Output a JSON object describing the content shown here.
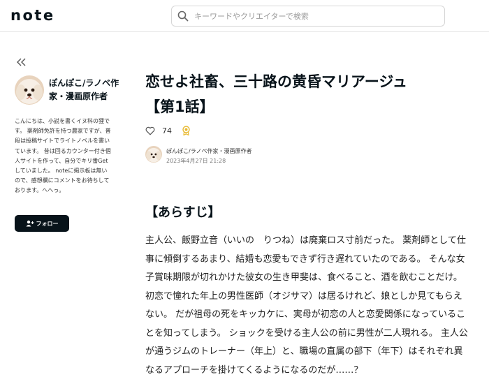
{
  "header": {
    "logo": "note",
    "search_placeholder": "キーワードやクリエイターで検索"
  },
  "sidebar": {
    "author_name": "ぽんぽこ/ラノベ作家・漫画原作者",
    "bio": "こんにちは、小説を書くイヌ科の狸です。 薬剤師免許を持つ農家ですが、普段は投稿サイトでライトノベルを書いています。 昔は回るカウンター付き個人サイトを作って、自分でキリ番Getしていました。 noteに掲示板は無いので、感想欄にコメントをお待ちしております。へへっ。",
    "follow_label": "フォロー"
  },
  "article": {
    "title_line1": "恋せよ社畜、三十路の黄昏マリアージュ",
    "title_line2": "【第1話】",
    "likes": "74",
    "author": "ぽんぽこ/ラノベ作家・漫画原作者",
    "date": "2023年4月27日 21:28",
    "section_heading": "【あらすじ】",
    "synopsis": "主人公、飯野立音（いいの　りつね）は廃棄ロス寸前だった。 薬剤師として仕事に傾倒するあまり、結婚も恋愛もできず行き遅れていたのである。 そんな女子賞味期限が切れかけた彼女の生き甲斐は、食べること、酒を飲むことだけ。初恋で憧れた年上の男性医師（オジサマ）は居るけれど、娘としか見てもらえない。 だが祖母の死をキッカケに、実母が初恋の人と恋愛関係になっていることを知ってしまう。 ショックを受ける主人公の前に男性が二人現れる。 主人公が通うジムのトレーナー（年上）と、職場の直属の部下（年下）はそれぞれ異なるアプローチを掛けてくるようになるのだが……？"
  },
  "colors": {
    "text": "#08131a",
    "button_bg": "#08131a",
    "badge": "#e8b930"
  },
  "icons": {
    "collapse": "chevron-double-left-icon",
    "search": "search-icon",
    "like": "heart-icon",
    "badge": "award-badge-icon",
    "follow": "add-user-icon"
  }
}
